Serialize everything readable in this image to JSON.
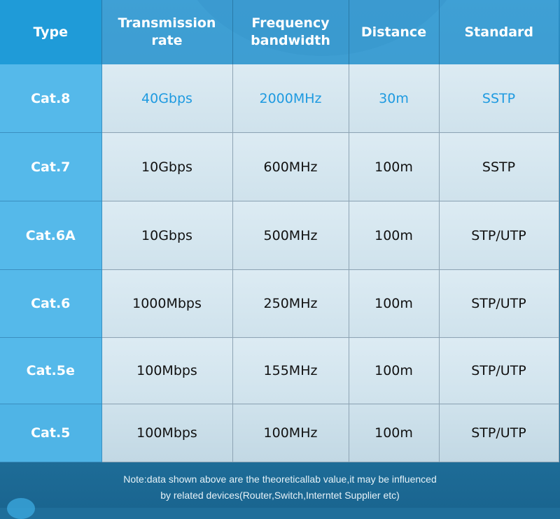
{
  "table": {
    "headers": [
      {
        "line1": "Type",
        "line2": ""
      },
      {
        "line1": "Transmission",
        "line2": "rate"
      },
      {
        "line1": "Frequency",
        "line2": "bandwidth"
      },
      {
        "line1": "Distance",
        "line2": ""
      },
      {
        "line1": "Standard",
        "line2": ""
      }
    ],
    "rows": [
      {
        "type": "Cat.8",
        "rate": "40Gbps",
        "bandwidth": "2000MHz",
        "distance": "30m",
        "standard": "SSTP",
        "highlight": true
      },
      {
        "type": "Cat.7",
        "rate": "10Gbps",
        "bandwidth": "600MHz",
        "distance": "100m",
        "standard": "SSTP",
        "highlight": false
      },
      {
        "type": "Cat.6A",
        "rate": "10Gbps",
        "bandwidth": "500MHz",
        "distance": "100m",
        "standard": "STP/UTP",
        "highlight": false
      },
      {
        "type": "Cat.6",
        "rate": "1000Mbps",
        "bandwidth": "250MHz",
        "distance": "100m",
        "standard": "STP/UTP",
        "highlight": false
      },
      {
        "type": "Cat.5e",
        "rate": "100Mbps",
        "bandwidth": "155MHz",
        "distance": "100m",
        "standard": "STP/UTP",
        "highlight": false
      },
      {
        "type": "Cat.5",
        "rate": "100Mbps",
        "bandwidth": "100MHz",
        "distance": "100m",
        "standard": "STP/UTP",
        "highlight": false
      }
    ]
  },
  "note": {
    "line1": "Note:data shown above are the theoreticallab value,it may be influenced",
    "line2": "by related devices(Router,Switch,Interntet Supplier etc)"
  },
  "colors": {
    "header_bg": "#2a8ec5",
    "type_column": "#55b9ea",
    "highlight_text": "#1e9ae0",
    "cell_bg": "#d6e7f0"
  }
}
